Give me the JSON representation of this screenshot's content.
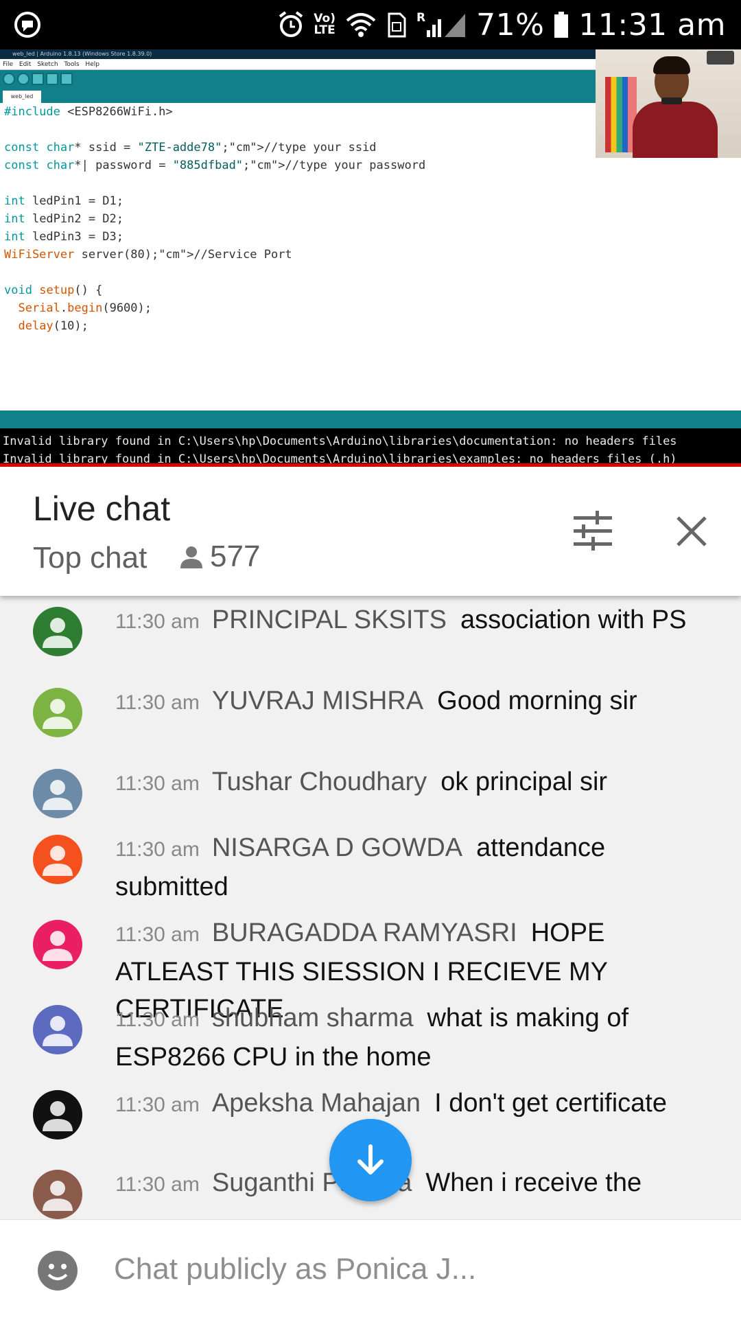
{
  "status_bar": {
    "volte_line1": "Vo)",
    "volte_line2": "LTE",
    "signal_r": "R",
    "battery": "71%",
    "time": "11:31 am",
    "icons": [
      "cast-icon",
      "alarm-icon",
      "volte-icon",
      "wifi-icon",
      "sim-icon",
      "signal-icon",
      "battery-icon"
    ]
  },
  "video": {
    "ide": {
      "title": "web_led | Arduino 1.8.13 (Windows Store 1.8.39.0)",
      "menu": "File Edit Sketch Tools Help",
      "tab": "web_led",
      "code": [
        "#include <ESP8266WiFi.h>",
        "",
        "const char* ssid = \"ZTE-adde78\";//type your ssid",
        "const char*| password = \"885dfbad\";//type your password",
        "",
        "int ledPin1 = D1;",
        "int ledPin2 = D2;",
        "int ledPin3 = D3;",
        "WiFiServer server(80);//Service Port",
        "",
        "void setup() {",
        "  Serial.begin(9600);",
        "  delay(10);"
      ],
      "console": [
        "Invalid library found in C:\\Users\\hp\\Documents\\Arduino\\libraries\\documentation: no headers files",
        "Invalid library found in C:\\Users\\hp\\Documents\\Arduino\\libraries\\examples: no headers files (.h)"
      ]
    },
    "progress_color": "#dd0000"
  },
  "chat": {
    "title": "Live chat",
    "mode": "Top chat",
    "viewer_count": "577",
    "messages": [
      {
        "time": "11:30 am",
        "author": "PRINCIPAL SKSITS",
        "text": "association with PS",
        "avatar_color": "#2e7d32"
      },
      {
        "time": "11:30 am",
        "author": "YUVRAJ MISHRA",
        "text": "Good morning sir",
        "avatar_color": "#7cb342"
      },
      {
        "time": "11:30 am",
        "author": "Tushar Choudhary",
        "text": "ok principal sir",
        "avatar_color": "#6d8aa6"
      },
      {
        "time": "11:30 am",
        "author": "NISARGA D GOWDA",
        "text": "attendance submitted",
        "avatar_color": "#f4511e"
      },
      {
        "time": "11:30 am",
        "author": "BURAGADDA RAMYASRI",
        "text": "HOPE ATLEAST THIS SIESSION I RECIEVE MY CERTIFICATE",
        "avatar_color": "#e91e63"
      },
      {
        "time": "11:30 am",
        "author": "shubham sharma",
        "text": "what is making of ESP8266 CPU in the home",
        "avatar_color": "#5c6bc0"
      },
      {
        "time": "11:30 am",
        "author": "Apeksha Mahajan",
        "text": "I don't get certificate",
        "avatar_color": "#111111"
      },
      {
        "time": "11:30 am",
        "author": "Suganthi Pathma",
        "text": "When i receive the",
        "avatar_color": "#8a5a4a"
      }
    ],
    "input_placeholder": "Chat publicly as Ponica J...",
    "fab_color": "#2196f3"
  }
}
